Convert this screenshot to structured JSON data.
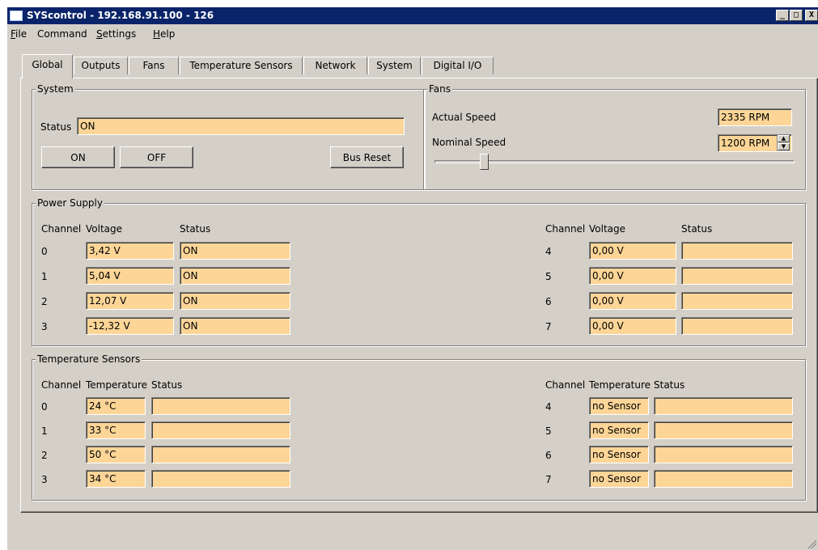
{
  "window": {
    "title": "SYScontrol - 192.168.91.100 - 126",
    "minimize_label": "_",
    "maximize_label": "□",
    "close_label": "X"
  },
  "menu": [
    {
      "label": "File",
      "mnemonic": "F",
      "rest": "ile"
    },
    {
      "label": "Command",
      "mnemonic": "",
      "rest": "Command"
    },
    {
      "label": "Settings",
      "mnemonic": "S",
      "rest": "ettings"
    },
    {
      "label": "Help",
      "mnemonic": "H",
      "rest": "elp"
    }
  ],
  "tabs": [
    "Global",
    "Outputs",
    "Fans",
    "Temperature Sensors",
    "Network",
    "System",
    "Digital I/O"
  ],
  "active_tab": "Global",
  "system": {
    "group_label": "System",
    "status_label": "Status",
    "status_value": "ON",
    "on_label": "ON",
    "off_label": "OFF",
    "bus_reset_label": "Bus Reset"
  },
  "fans": {
    "group_label": "Fans",
    "actual_speed_label": "Actual Speed",
    "actual_speed_value": "2335 RPM",
    "nominal_speed_label": "Nominal Speed",
    "nominal_speed_value": "1200 RPM",
    "slider_fraction": 0.13
  },
  "power_supply": {
    "group_label": "Power Supply",
    "headers": {
      "channel": "Channel",
      "voltage": "Voltage",
      "status": "Status"
    },
    "left": [
      {
        "channel": "0",
        "voltage": "3,42 V",
        "status": "ON"
      },
      {
        "channel": "1",
        "voltage": "5,04 V",
        "status": "ON"
      },
      {
        "channel": "2",
        "voltage": "12,07 V",
        "status": "ON"
      },
      {
        "channel": "3",
        "voltage": "-12,32 V",
        "status": "ON"
      }
    ],
    "right": [
      {
        "channel": "4",
        "voltage": "0,00 V",
        "status": ""
      },
      {
        "channel": "5",
        "voltage": "0,00 V",
        "status": ""
      },
      {
        "channel": "6",
        "voltage": "0,00 V",
        "status": ""
      },
      {
        "channel": "7",
        "voltage": "0,00 V",
        "status": ""
      }
    ]
  },
  "temperature_sensors": {
    "group_label": "Temperature Sensors",
    "headers": {
      "channel": "Channel",
      "temperature": "Temperature",
      "status": "Status"
    },
    "left": [
      {
        "channel": "0",
        "temperature": "24 °C",
        "status": ""
      },
      {
        "channel": "1",
        "temperature": "33 °C",
        "status": ""
      },
      {
        "channel": "2",
        "temperature": "50 °C",
        "status": ""
      },
      {
        "channel": "3",
        "temperature": "34 °C",
        "status": ""
      }
    ],
    "right": [
      {
        "channel": "4",
        "temperature": "no Sensor",
        "status": ""
      },
      {
        "channel": "5",
        "temperature": "no Sensor",
        "status": ""
      },
      {
        "channel": "6",
        "temperature": "no Sensor",
        "status": ""
      },
      {
        "channel": "7",
        "temperature": "no Sensor",
        "status": ""
      }
    ]
  },
  "colors": {
    "titlebar": "#0a246a",
    "field_fill": "#fcd597",
    "face": "#d4d0c8"
  }
}
